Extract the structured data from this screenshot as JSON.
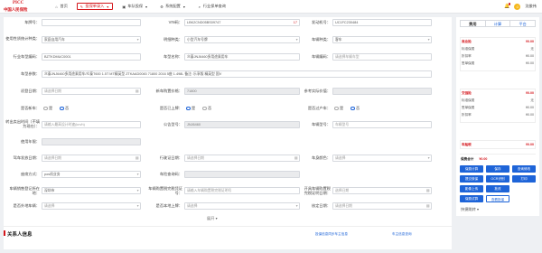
{
  "app": {
    "brand_top": "PICC",
    "brand_name": "中国人民保险"
  },
  "nav": [
    {
      "label": "首页",
      "icon": "home-icon"
    },
    {
      "label": "投保单录入",
      "icon": "edit-icon",
      "active": true
    },
    {
      "label": "车队投保",
      "icon": "car-icon"
    },
    {
      "label": "系统配置",
      "icon": "gear-icon"
    },
    {
      "label": "行业保单查询",
      "icon": "search-icon"
    }
  ],
  "user": {
    "name": "沈俊伟",
    "badge": "4"
  },
  "form": {
    "plate_label": "车牌号：",
    "vin_label": "VIN码：",
    "vin_value": "LBK2CND05BS09747",
    "vin_count": "17",
    "engine_label": "发动机号：",
    "engine_value": "UC1FC230484",
    "usage_label": "使用性质统计种类：",
    "usage_value": "家庭自用汽车",
    "vehicle_type_label": "明细种类：",
    "vehicle_type_value": "小型汽车号牌",
    "plate_type_label": "车辆种类：",
    "plate_type_value": "客车",
    "industry_model_label": "行业车型编码：",
    "industry_model_value": "BZTKDMUC0001",
    "vehicle_model_label": "车型名称：",
    "vehicle_model_value": "众泰JNJ6460多用途乘用车",
    "vehicle_code_label": "车辆编码：",
    "vehicle_code_placeholder": "请选择车辆车型",
    "params_label": "车型参数：",
    "params_value": "众泰JNJ6460多用途乘用车/众泰T600 1.5T MT精英型 ZTKAAD0045 71800 2016 5座 1.498L 备注: 乐享版 精英型 国V",
    "reg_date_label": "初登日期：",
    "reg_date_placeholder": "请选择日期",
    "new_price_label": "新车购置价格：",
    "new_price_value": "71800",
    "ref_price_label": "参考实际价值：",
    "new_car_label": "是否新车：",
    "yes": "是",
    "no": "否",
    "on_road_label": "是否已上牌：",
    "transfer_label": "是否过户车：",
    "resale_label": "转出卖出时间（不填为现在）：",
    "resale_placeholder": "请输入最高设计时速(km/h)",
    "announce_label": "公告型号：",
    "announce_value": "JNJ6460",
    "plate_model_label": "车辆型号：",
    "plate_model_placeholder": "车辆型号",
    "use_years_label": "使用年限：",
    "first_reg_label": "驾车发放日期：",
    "first_reg_placeholder": "请选择日期",
    "license_label": "行驶证日期：",
    "license_placeholder": "请选择日期",
    "fuel_label": "车身颜色：",
    "fuel_placeholder": "请选择",
    "seat_label": "座席方式：",
    "seat_value": "pos机业务",
    "car_check_label": "车险查询码：",
    "insured_city_label": "车辆销售登记所在地：",
    "insured_city_value": "深圳市",
    "tax_label": "车辆购置税完税凭证号：",
    "tax_placeholder": "请输入车辆购置税完税证明号",
    "cert_date_label": "开具车辆购置税完税证明日期：",
    "cert_date_placeholder": "选择日期",
    "new_plate_label": "是否外地车辆：",
    "new_plate_placeholder": "请选择",
    "local_plate_label": "是否本地上牌：",
    "local_plate_placeholder": "请选择",
    "loan_label": "核定日期：",
    "loan_placeholder": "请选择日期",
    "expand": "展开"
  },
  "section": {
    "title": "关系人信息",
    "link1": "投保信息同步车主信息",
    "link2": "车主信息查询"
  },
  "side": {
    "tabs": [
      "费用",
      "计算",
      "平台"
    ],
    "card1": {
      "title": "商业险",
      "title_val": "¥0.00",
      "rows": [
        [
          "标准保费",
          "无"
        ],
        [
          "折扣率",
          "¥0.00"
        ],
        [
          "签单保费",
          "¥0.00"
        ]
      ]
    },
    "card2": {
      "title": "交强险",
      "title_val": "¥0.00",
      "rows": [
        [
          "标准保费",
          "无"
        ],
        [
          "签单保费",
          "¥0.00"
        ],
        [
          "折扣率",
          "¥0.00"
        ]
      ]
    },
    "tax": {
      "label": "车船税",
      "value": "¥0.00"
    },
    "total": {
      "label": "保费合计",
      "value": "¥0.00"
    },
    "buttons": [
      "保费计算",
      "保存",
      "查询修改",
      "提交核保",
      "OCR识别",
      "打印",
      "影像上传",
      "批改",
      "保费试算",
      "查看投保"
    ],
    "fast": "快捷跳转"
  },
  "colors": {
    "accent": "#d4161c",
    "primary": "#1e64d8"
  }
}
